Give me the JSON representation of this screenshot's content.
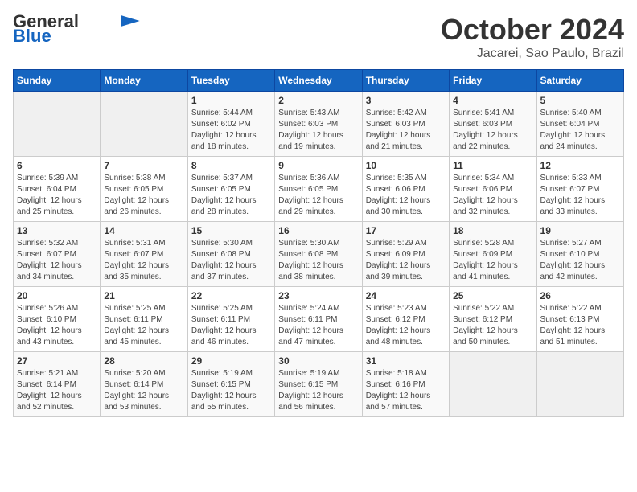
{
  "header": {
    "logo_line1": "General",
    "logo_line2": "Blue",
    "month": "October 2024",
    "location": "Jacarei, Sao Paulo, Brazil"
  },
  "days_of_week": [
    "Sunday",
    "Monday",
    "Tuesday",
    "Wednesday",
    "Thursday",
    "Friday",
    "Saturday"
  ],
  "weeks": [
    [
      {
        "day": "",
        "info": ""
      },
      {
        "day": "",
        "info": ""
      },
      {
        "day": "1",
        "info": "Sunrise: 5:44 AM\nSunset: 6:02 PM\nDaylight: 12 hours and 18 minutes."
      },
      {
        "day": "2",
        "info": "Sunrise: 5:43 AM\nSunset: 6:03 PM\nDaylight: 12 hours and 19 minutes."
      },
      {
        "day": "3",
        "info": "Sunrise: 5:42 AM\nSunset: 6:03 PM\nDaylight: 12 hours and 21 minutes."
      },
      {
        "day": "4",
        "info": "Sunrise: 5:41 AM\nSunset: 6:03 PM\nDaylight: 12 hours and 22 minutes."
      },
      {
        "day": "5",
        "info": "Sunrise: 5:40 AM\nSunset: 6:04 PM\nDaylight: 12 hours and 24 minutes."
      }
    ],
    [
      {
        "day": "6",
        "info": "Sunrise: 5:39 AM\nSunset: 6:04 PM\nDaylight: 12 hours and 25 minutes."
      },
      {
        "day": "7",
        "info": "Sunrise: 5:38 AM\nSunset: 6:05 PM\nDaylight: 12 hours and 26 minutes."
      },
      {
        "day": "8",
        "info": "Sunrise: 5:37 AM\nSunset: 6:05 PM\nDaylight: 12 hours and 28 minutes."
      },
      {
        "day": "9",
        "info": "Sunrise: 5:36 AM\nSunset: 6:05 PM\nDaylight: 12 hours and 29 minutes."
      },
      {
        "day": "10",
        "info": "Sunrise: 5:35 AM\nSunset: 6:06 PM\nDaylight: 12 hours and 30 minutes."
      },
      {
        "day": "11",
        "info": "Sunrise: 5:34 AM\nSunset: 6:06 PM\nDaylight: 12 hours and 32 minutes."
      },
      {
        "day": "12",
        "info": "Sunrise: 5:33 AM\nSunset: 6:07 PM\nDaylight: 12 hours and 33 minutes."
      }
    ],
    [
      {
        "day": "13",
        "info": "Sunrise: 5:32 AM\nSunset: 6:07 PM\nDaylight: 12 hours and 34 minutes."
      },
      {
        "day": "14",
        "info": "Sunrise: 5:31 AM\nSunset: 6:07 PM\nDaylight: 12 hours and 35 minutes."
      },
      {
        "day": "15",
        "info": "Sunrise: 5:30 AM\nSunset: 6:08 PM\nDaylight: 12 hours and 37 minutes."
      },
      {
        "day": "16",
        "info": "Sunrise: 5:30 AM\nSunset: 6:08 PM\nDaylight: 12 hours and 38 minutes."
      },
      {
        "day": "17",
        "info": "Sunrise: 5:29 AM\nSunset: 6:09 PM\nDaylight: 12 hours and 39 minutes."
      },
      {
        "day": "18",
        "info": "Sunrise: 5:28 AM\nSunset: 6:09 PM\nDaylight: 12 hours and 41 minutes."
      },
      {
        "day": "19",
        "info": "Sunrise: 5:27 AM\nSunset: 6:10 PM\nDaylight: 12 hours and 42 minutes."
      }
    ],
    [
      {
        "day": "20",
        "info": "Sunrise: 5:26 AM\nSunset: 6:10 PM\nDaylight: 12 hours and 43 minutes."
      },
      {
        "day": "21",
        "info": "Sunrise: 5:25 AM\nSunset: 6:11 PM\nDaylight: 12 hours and 45 minutes."
      },
      {
        "day": "22",
        "info": "Sunrise: 5:25 AM\nSunset: 6:11 PM\nDaylight: 12 hours and 46 minutes."
      },
      {
        "day": "23",
        "info": "Sunrise: 5:24 AM\nSunset: 6:11 PM\nDaylight: 12 hours and 47 minutes."
      },
      {
        "day": "24",
        "info": "Sunrise: 5:23 AM\nSunset: 6:12 PM\nDaylight: 12 hours and 48 minutes."
      },
      {
        "day": "25",
        "info": "Sunrise: 5:22 AM\nSunset: 6:12 PM\nDaylight: 12 hours and 50 minutes."
      },
      {
        "day": "26",
        "info": "Sunrise: 5:22 AM\nSunset: 6:13 PM\nDaylight: 12 hours and 51 minutes."
      }
    ],
    [
      {
        "day": "27",
        "info": "Sunrise: 5:21 AM\nSunset: 6:14 PM\nDaylight: 12 hours and 52 minutes."
      },
      {
        "day": "28",
        "info": "Sunrise: 5:20 AM\nSunset: 6:14 PM\nDaylight: 12 hours and 53 minutes."
      },
      {
        "day": "29",
        "info": "Sunrise: 5:19 AM\nSunset: 6:15 PM\nDaylight: 12 hours and 55 minutes."
      },
      {
        "day": "30",
        "info": "Sunrise: 5:19 AM\nSunset: 6:15 PM\nDaylight: 12 hours and 56 minutes."
      },
      {
        "day": "31",
        "info": "Sunrise: 5:18 AM\nSunset: 6:16 PM\nDaylight: 12 hours and 57 minutes."
      },
      {
        "day": "",
        "info": ""
      },
      {
        "day": "",
        "info": ""
      }
    ]
  ]
}
